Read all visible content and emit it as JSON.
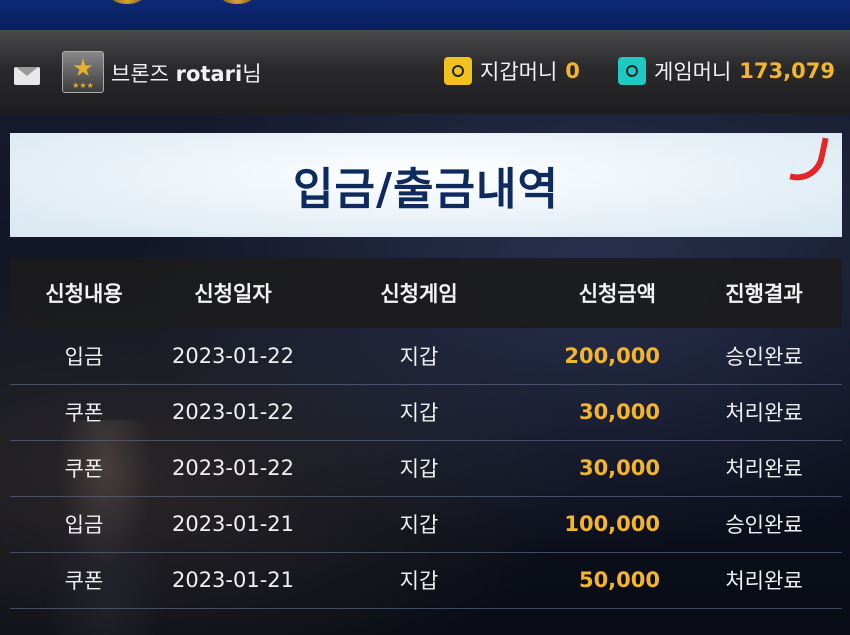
{
  "user": {
    "rank": "브론즈",
    "id": "rotari",
    "suffix": "님"
  },
  "wallets": [
    {
      "label": "지갑머니",
      "value": "0",
      "icon": "safe-gold-icon",
      "color": "#f1c21b"
    },
    {
      "label": "게임머니",
      "value": "173,079",
      "icon": "safe-teal-icon",
      "color": "#1ec8c3"
    }
  ],
  "page_title": "입금/출금내역",
  "table": {
    "headers": [
      "신청내용",
      "신청일자",
      "신청게임",
      "신청금액",
      "진행결과"
    ],
    "rows": [
      [
        "입금",
        "2023-01-22",
        "지갑",
        "200,000",
        "승인완료"
      ],
      [
        "쿠폰",
        "2023-01-22",
        "지갑",
        "30,000",
        "처리완료"
      ],
      [
        "쿠폰",
        "2023-01-22",
        "지갑",
        "30,000",
        "처리완료"
      ],
      [
        "입금",
        "2023-01-21",
        "지갑",
        "100,000",
        "승인완료"
      ],
      [
        "쿠폰",
        "2023-01-21",
        "지갑",
        "50,000",
        "처리완료"
      ]
    ]
  },
  "colors": {
    "amount": "#f4b52c",
    "title": "#0e2a5e",
    "accent_mark": "#e32626"
  }
}
